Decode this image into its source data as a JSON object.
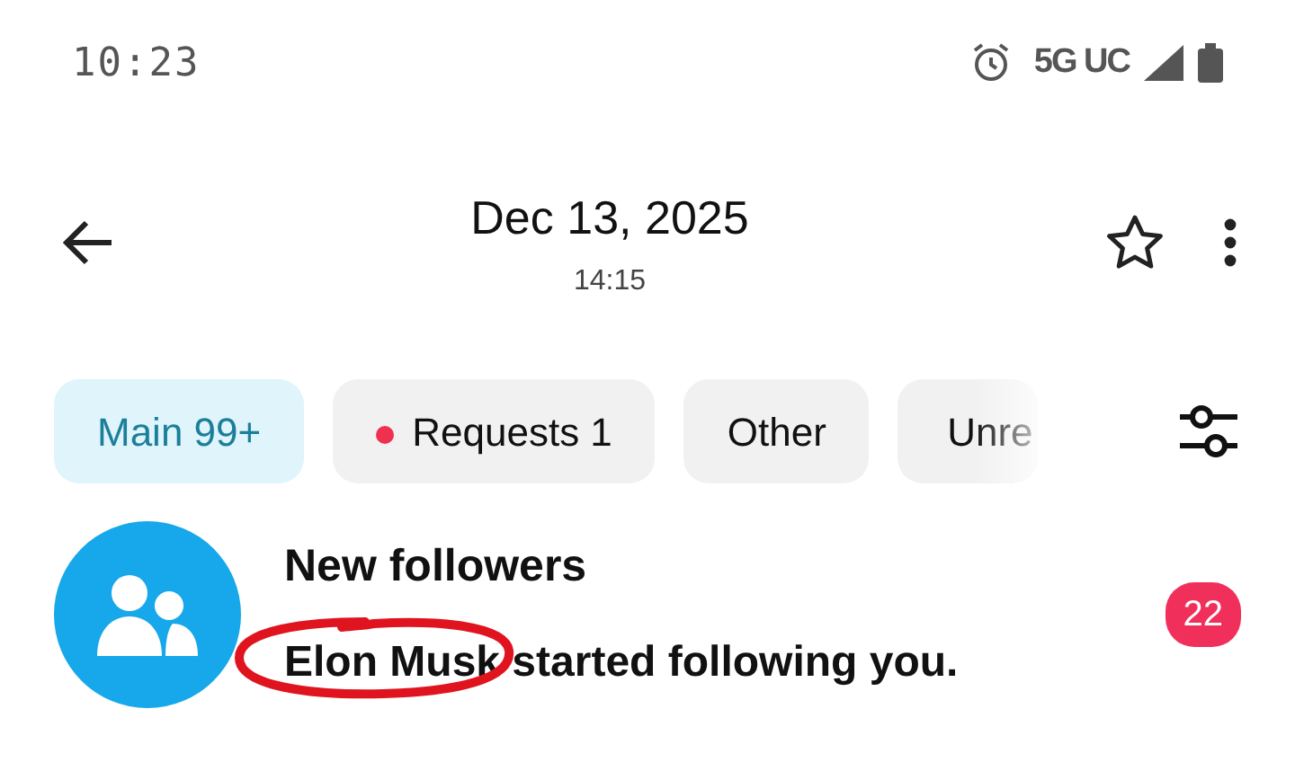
{
  "status_bar": {
    "time": "10:23",
    "network": "5G UC"
  },
  "header": {
    "title": "Dec 13, 2025",
    "subtitle": "14:15",
    "starred": false
  },
  "tabs": [
    {
      "label": "Main 99+",
      "selected": true,
      "dot": false
    },
    {
      "label": "Requests 1",
      "selected": false,
      "dot": true
    },
    {
      "label": "Other",
      "selected": false,
      "dot": false
    },
    {
      "label": "Unre",
      "selected": false,
      "dot": false
    }
  ],
  "notification": {
    "title": "New followers",
    "text": "Elon Musk started following you.",
    "badge": "22",
    "circled": true
  }
}
